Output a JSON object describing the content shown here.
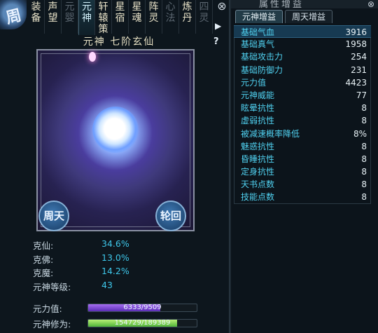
{
  "left_panel": {
    "corner_badge": "周",
    "tabs": [
      {
        "chars": "装备",
        "state": "normal"
      },
      {
        "chars": "声望",
        "state": "normal"
      },
      {
        "chars": "元婴",
        "state": "dim"
      },
      {
        "chars": "元神",
        "state": "active"
      },
      {
        "chars": "轩辕策",
        "state": "normal"
      },
      {
        "chars": "星宿",
        "state": "normal"
      },
      {
        "chars": "星魂",
        "state": "normal"
      },
      {
        "chars": "阵灵",
        "state": "normal"
      },
      {
        "chars": "心法",
        "state": "dim"
      },
      {
        "chars": "炼丹",
        "state": "normal"
      },
      {
        "chars": "四灵",
        "state": "dim"
      }
    ],
    "close": "⊗",
    "arrow": "▶",
    "help": "?",
    "title": "元神 七阶玄仙",
    "button_zhoutian": "周天",
    "button_lunhui": "轮回",
    "resistances": [
      {
        "label": "克仙:",
        "value": "34.6%"
      },
      {
        "label": "克佛:",
        "value": "13.0%"
      },
      {
        "label": "克魔:",
        "value": "14.2%"
      },
      {
        "label": "元神等级:",
        "value": "43"
      }
    ],
    "bars": [
      {
        "label": "元力值:",
        "text": "6333/9509",
        "fraction": 0.666,
        "color": "purple"
      },
      {
        "label": "元神修为:",
        "text": "154729/189389",
        "fraction": 0.817,
        "color": "green"
      }
    ]
  },
  "right_panel": {
    "title": "属性增益",
    "close": "⊗",
    "tabs": [
      {
        "label": "元神增益",
        "active": true
      },
      {
        "label": "周天增益",
        "active": false
      }
    ],
    "stats": [
      {
        "label": "基础气血",
        "value": "3916",
        "highlight": true
      },
      {
        "label": "基础真气",
        "value": "1958",
        "highlight": false
      },
      {
        "label": "基础攻击力",
        "value": "254",
        "highlight": false
      },
      {
        "label": "基础防御力",
        "value": "231",
        "highlight": false
      },
      {
        "label": "元力值",
        "value": "4423",
        "highlight": false
      },
      {
        "label": "元神威能",
        "value": "77",
        "highlight": false
      },
      {
        "label": "眩晕抗性",
        "value": "8",
        "highlight": false
      },
      {
        "label": "虚弱抗性",
        "value": "8",
        "highlight": false
      },
      {
        "label": "被减速概率降低",
        "value": "8%",
        "highlight": false
      },
      {
        "label": "魅惑抗性",
        "value": "8",
        "highlight": false
      },
      {
        "label": "昏睡抗性",
        "value": "8",
        "highlight": false
      },
      {
        "label": "定身抗性",
        "value": "8",
        "highlight": false
      },
      {
        "label": "天书点数",
        "value": "8",
        "highlight": false
      },
      {
        "label": "技能点数",
        "value": "8",
        "highlight": false
      }
    ]
  }
}
